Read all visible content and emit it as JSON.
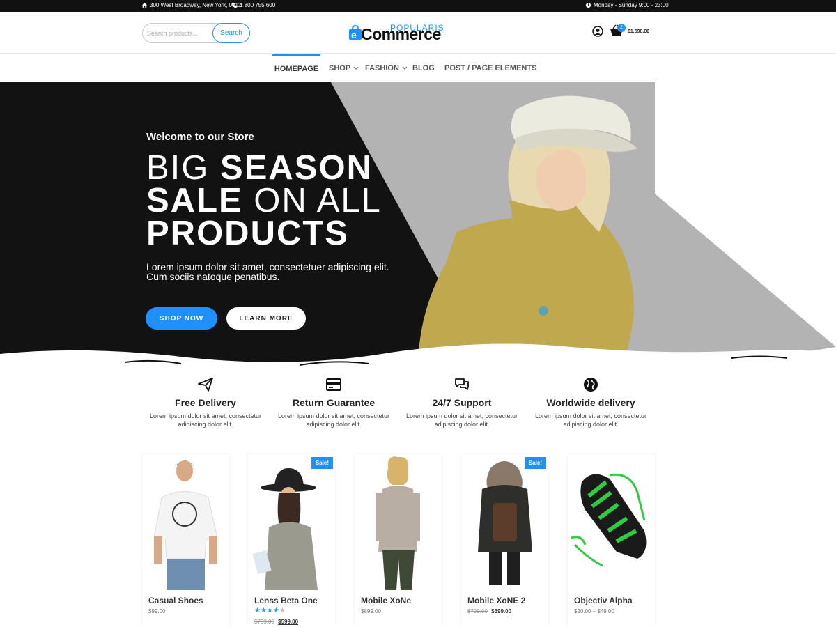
{
  "topbar": {
    "address": "300 West Broadway, New York, 0012",
    "phone": "1 800 755 600",
    "hours": "Monday - Sunday 9:00 - 23:00"
  },
  "header": {
    "search_placeholder": "Search products...",
    "search_button": "Search",
    "logo_main": "Commerce",
    "logo_letter": "e",
    "logo_small": "POPULARIS",
    "cart_count": "2",
    "cart_total": "$1,598.00"
  },
  "nav": {
    "items": [
      "HOMEPAGE",
      "SHOP",
      "FASHION",
      "BLOG",
      "POST / PAGE ELEMENTS"
    ],
    "active": "HOMEPAGE"
  },
  "hero": {
    "subtitle": "Welcome to our Store",
    "title_line1_light": "BIG ",
    "title_line1_bold": "SEASON",
    "title_line2_bold": "SALE",
    "title_line2_light": " ON ALL",
    "title_line3_bold": "PRODUCTS",
    "description": "Lorem ipsum dolor sit amet, consectetuer adipiscing elit. Cum sociis natoque penatibus.",
    "shop_button": "SHOP NOW",
    "learn_button": "LEARN MORE"
  },
  "features": [
    {
      "title": "Free Delivery",
      "desc": "Lorem ipsum dolor sit amet, consectetur adipiscing dolor elit.",
      "icon": "paper-plane-icon"
    },
    {
      "title": "Return Guarantee",
      "desc": "Lorem ipsum dolor sit amet, consectetur adipiscing dolor elit.",
      "icon": "credit-card-icon"
    },
    {
      "title": "24/7 Support",
      "desc": "Lorem ipsum dolor sit amet, consectetur adipiscing dolor elit.",
      "icon": "chat-bubbles-icon"
    },
    {
      "title": "Worldwide delivery",
      "desc": "Lorem ipsum dolor sit amet, consectetur adipiscing dolor elit.",
      "icon": "globe-icon"
    }
  ],
  "products": [
    {
      "name": "Casual Shoes",
      "price": "$99.00",
      "sale": false
    },
    {
      "name": "Lenss Beta One",
      "old_price": "$799.00",
      "price": "$599.00",
      "sale": true,
      "sale_label": "Sale!",
      "rating": 4,
      "rating_max": 5
    },
    {
      "name": "Mobile XoNe",
      "price": "$899.00",
      "sale": false
    },
    {
      "name": "Mobile XoNE 2",
      "old_price": "$799.00",
      "price": "$699.00",
      "sale": true,
      "sale_label": "Sale!"
    },
    {
      "name": "Objectiv Alpha",
      "price": "$20.00 – $49.00",
      "sale": false
    }
  ],
  "colors": {
    "accent": "#1e90ff",
    "dark": "#111111",
    "hero_grey": "#b3b3b3"
  }
}
